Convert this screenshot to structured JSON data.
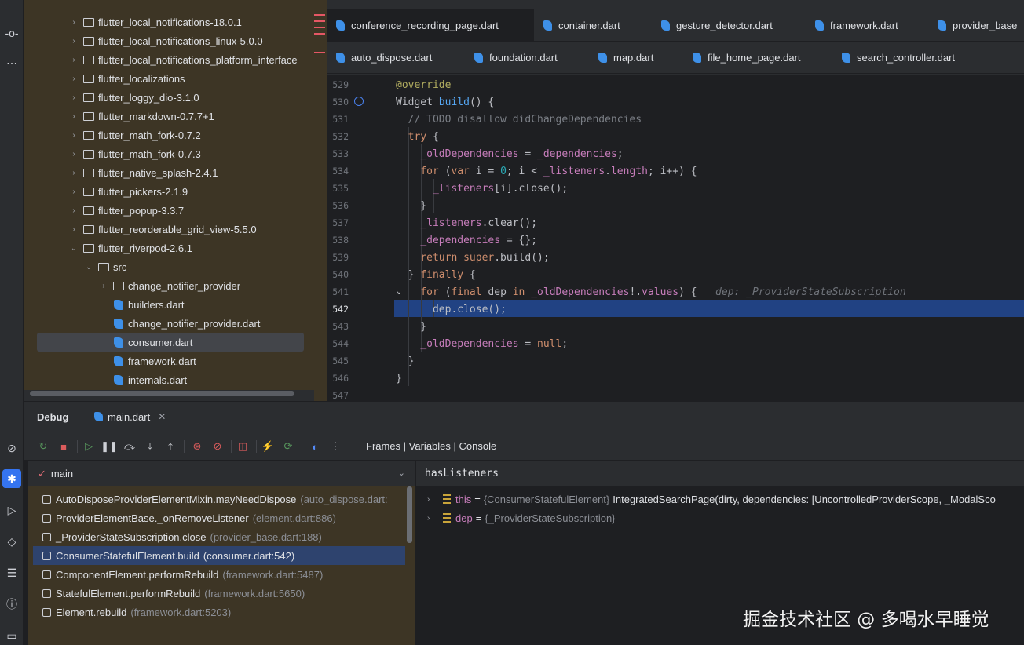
{
  "left_strip": {
    "top_icons": [
      "commit-icon",
      "more-icon"
    ],
    "bottom_icons": [
      "run-dashboard-icon",
      "debug-icon",
      "run-icon",
      "flutter-inspector-icon",
      "performance-icon",
      "problems-icon",
      "terminal-icon"
    ]
  },
  "project_tree": {
    "items": [
      {
        "label": "flutter_local_notifications-18.0.1",
        "kind": "folder",
        "depth": 0,
        "expanded": false
      },
      {
        "label": "flutter_local_notifications_linux-5.0.0",
        "kind": "folder",
        "depth": 0,
        "expanded": false
      },
      {
        "label": "flutter_local_notifications_platform_interface",
        "kind": "folder",
        "depth": 0,
        "expanded": false
      },
      {
        "label": "flutter_localizations",
        "kind": "folder",
        "depth": 0,
        "expanded": false
      },
      {
        "label": "flutter_loggy_dio-3.1.0",
        "kind": "folder",
        "depth": 0,
        "expanded": false
      },
      {
        "label": "flutter_markdown-0.7.7+1",
        "kind": "folder",
        "depth": 0,
        "expanded": false
      },
      {
        "label": "flutter_math_fork-0.7.2",
        "kind": "folder",
        "depth": 0,
        "expanded": false
      },
      {
        "label": "flutter_math_fork-0.7.3",
        "kind": "folder",
        "depth": 0,
        "expanded": false
      },
      {
        "label": "flutter_native_splash-2.4.1",
        "kind": "folder",
        "depth": 0,
        "expanded": false
      },
      {
        "label": "flutter_pickers-2.1.9",
        "kind": "folder",
        "depth": 0,
        "expanded": false
      },
      {
        "label": "flutter_popup-3.3.7",
        "kind": "folder",
        "depth": 0,
        "expanded": false
      },
      {
        "label": "flutter_reorderable_grid_view-5.5.0",
        "kind": "folder",
        "depth": 0,
        "expanded": false
      },
      {
        "label": "flutter_riverpod-2.6.1",
        "kind": "folder",
        "depth": 0,
        "expanded": true
      },
      {
        "label": "src",
        "kind": "folder",
        "depth": 1,
        "expanded": true
      },
      {
        "label": "change_notifier_provider",
        "kind": "folder",
        "depth": 2,
        "expanded": false
      },
      {
        "label": "builders.dart",
        "kind": "dart",
        "depth": 2
      },
      {
        "label": "change_notifier_provider.dart",
        "kind": "dart",
        "depth": 2
      },
      {
        "label": "consumer.dart",
        "kind": "dart",
        "depth": 2,
        "selected": true
      },
      {
        "label": "framework.dart",
        "kind": "dart",
        "depth": 2
      },
      {
        "label": "internals.dart",
        "kind": "dart",
        "depth": 2
      }
    ]
  },
  "editor_tabs": {
    "row1": [
      "conference_recording_page.dart",
      "container.dart",
      "gesture_detector.dart",
      "framework.dart",
      "provider_base"
    ],
    "row2": [
      "auto_dispose.dart",
      "foundation.dart",
      "map.dart",
      "file_home_page.dart",
      "search_controller.dart"
    ]
  },
  "code": {
    "current_line": "542",
    "lines": [
      {
        "n": "529",
        "html": "<span class=\"a\">@override</span>"
      },
      {
        "n": "530",
        "html": "Widget <span class=\"f\">build</span>() {"
      },
      {
        "n": "531",
        "html": "  <span class=\"c\">// TODO disallow didChangeDependencies</span>"
      },
      {
        "n": "532",
        "html": "  <span class=\"k\">try</span> {"
      },
      {
        "n": "533",
        "html": "    <span class=\"v\">_oldDependencies</span> = <span class=\"v\">_dependencies</span>;"
      },
      {
        "n": "534",
        "html": "    <span class=\"k\">for</span> (<span class=\"k\">var</span> i = <span class=\"n\">0</span>; i &lt; <span class=\"v\">_listeners</span>.<span class=\"v\">length</span>; i++) {"
      },
      {
        "n": "535",
        "html": "      <span class=\"v\">_listeners</span>[i].close();"
      },
      {
        "n": "536",
        "html": "    }"
      },
      {
        "n": "537",
        "html": "    <span class=\"v\">_listeners</span>.clear();"
      },
      {
        "n": "538",
        "html": "    <span class=\"v\">_dependencies</span> = {};"
      },
      {
        "n": "539",
        "html": "    <span class=\"k\">return super</span>.build();"
      },
      {
        "n": "540",
        "html": "  } <span class=\"k\">finally</span> {"
      },
      {
        "n": "541",
        "html": "    <span class=\"k\">for</span> (<span class=\"k\">final</span> dep <span class=\"k\">in</span> <span class=\"v\">_oldDependencies</span>!.<span class=\"v\">values</span>) {   <span class=\"hint\">dep: _ProviderStateSubscription</span>"
      },
      {
        "n": "542",
        "html": "      dep.close();"
      },
      {
        "n": "543",
        "html": "    }"
      },
      {
        "n": "544",
        "html": "    <span class=\"v\">_oldDependencies</span> = <span class=\"k\">null</span>;"
      },
      {
        "n": "545",
        "html": "  }"
      },
      {
        "n": "546",
        "html": "}"
      },
      {
        "n": "547",
        "html": ""
      }
    ]
  },
  "debug": {
    "title": "Debug",
    "session_tab": "main.dart",
    "panes_label": "Frames | Variables | Console",
    "thread": "main",
    "frames": [
      {
        "method": "AutoDisposeProviderElementMixin.mayNeedDispose",
        "location": "(auto_dispose.dart:",
        "selected": false
      },
      {
        "method": "ProviderElementBase._onRemoveListener",
        "location": "(element.dart:886)",
        "selected": false
      },
      {
        "method": "_ProviderStateSubscription.close",
        "location": "(provider_base.dart:188)",
        "selected": false
      },
      {
        "method": "ConsumerStatefulElement.build",
        "location": "(consumer.dart:542)",
        "selected": true
      },
      {
        "method": "ComponentElement.performRebuild",
        "location": "(framework.dart:5487)",
        "selected": false
      },
      {
        "method": "StatefulElement.performRebuild",
        "location": "(framework.dart:5650)",
        "selected": false
      },
      {
        "method": "Element.rebuild",
        "location": "(framework.dart:5203)",
        "selected": false
      }
    ],
    "watch_expression": "hasListeners",
    "variables": [
      {
        "name": "this",
        "type": "{ConsumerStatefulElement}",
        "value": "IntegratedSearchPage(dirty, dependencies: [UncontrolledProviderScope, _ModalSco"
      },
      {
        "name": "dep",
        "type": "{_ProviderStateSubscription}",
        "value": ""
      }
    ]
  },
  "watermark": "掘金技术社区 @ 多喝水早睡觉",
  "colors": {
    "accent": "#3574f0",
    "current_line_highlight": "#214283",
    "selected_frame": "#2e436e",
    "tree_background": "#3d3525",
    "editor_background": "#1e1f22"
  }
}
